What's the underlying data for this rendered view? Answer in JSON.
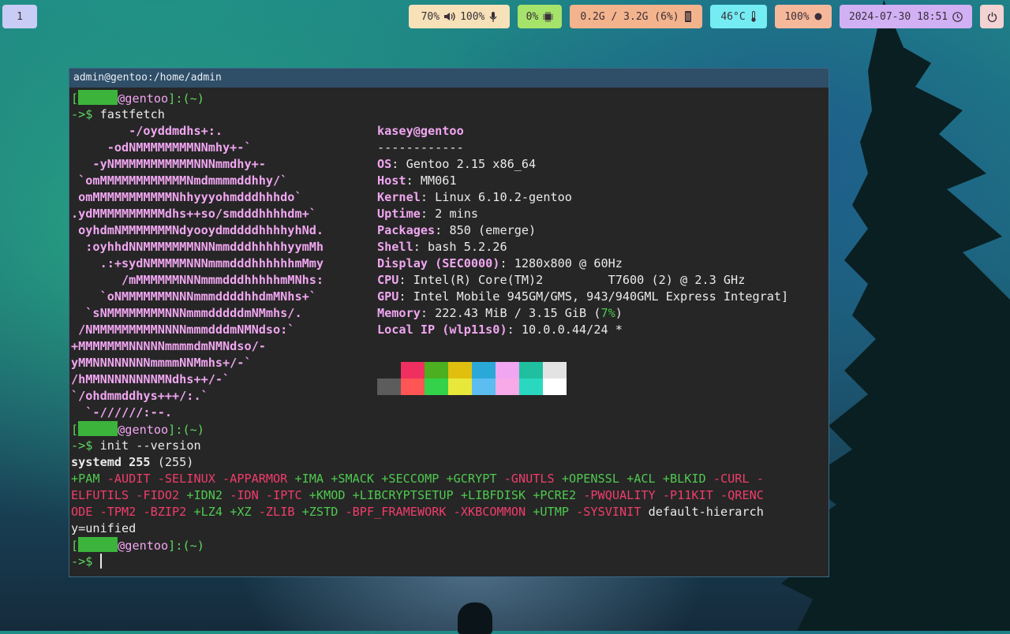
{
  "bar": {
    "workspace": "1",
    "audio": {
      "volume": "70%",
      "mic": "100%"
    },
    "cpu": "0%",
    "memory": "0.2G / 3.2G (6%)",
    "temperature": "46°C",
    "battery": "100%",
    "datetime": "2024-07-30 18:51",
    "colors": {
      "workspace": "#c9ccf5",
      "audio": "#f6e1b8",
      "cpu": "#a6e36a",
      "memory": "#f3b38c",
      "temp": "#74ecf2",
      "battery": "#f6b89a",
      "clock": "#d1b0f4",
      "power": "#f2d2d2"
    }
  },
  "terminal": {
    "title": "admin@gentoo:/home/admin",
    "prompt": {
      "open": "[",
      "host": "@gentoo",
      "close": "]",
      "path": ":(~)",
      "arrow": "->$"
    },
    "cmd1": "fastfetch",
    "cmd2": "init --version",
    "logo": [
      "        -/oyddmdhs+:.",
      "     -odNMMMMMMMMNNmhy+-`",
      "   -yNMMMMMMMMMMMNNNmmdhy+-",
      " `omMMMMMMMMMMMMNmdmmmmddhhy/`",
      " omMMMMMMMMMMMNhhyyyohmdddhhhdo`",
      ".ydMMMMMMMMMMdhs++so/smdddhhhhdm+`",
      " oyhdmNMMMMMMMNdyooydmddddhhhhyhNd.",
      "  :oyhhdNNMMMMMMMNNNmmdddhhhhhyymMh",
      "    .:+sydNMMMMMNNNmmmdddhhhhhhmMmy",
      "       /mMMMMMMNNNmmmdddhhhhhmMNhs:",
      "    `oNMMMMMMMNNNmmmddddhhdmMNhs+`",
      "  `sNMMMMMMMMNNNmmmdddddmNMmhs/.",
      " /NMMMMMMMMMNNNNmmmdddmNMNdso:`",
      "+MMMMMMMNNNNNmmmmdmNMNdso/-",
      "yMMNNNNNNNNmmmmNNMmhs+/-`",
      "/hMMNNNNNNNNMNdhs++/-`",
      "`/ohdmmddhys+++/:.`",
      "  `-//////:--."
    ],
    "info_header": "kasey@gentoo",
    "info_rule": "------------",
    "info": [
      {
        "key": "OS",
        "val": ": Gentoo 2.15 x86_64"
      },
      {
        "key": "Host",
        "val": ": MM061"
      },
      {
        "key": "Kernel",
        "val": ": Linux 6.10.2-gentoo"
      },
      {
        "key": "Uptime",
        "val": ": 2 mins"
      },
      {
        "key": "Packages",
        "val": ": 850 (emerge)"
      },
      {
        "key": "Shell",
        "val": ": bash 5.2.26"
      },
      {
        "key": "Display (SEC0000)",
        "val": ": 1280x800 @ 60Hz"
      },
      {
        "key": "CPU",
        "val": ": Intel(R) Core(TM)2         T7600 (2) @ 2.3 GHz"
      },
      {
        "key": "GPU",
        "val": ": Intel Mobile 945GM/GMS, 943/940GML Express Integrat]"
      },
      {
        "key": "Memory",
        "val": ": 222.43 MiB / 3.15 GiB (",
        "pct": "7%",
        "tail": ")"
      },
      {
        "key": "Local IP (wlp11s0)",
        "val": ": 10.0.0.44/24 *"
      }
    ],
    "palette_top": [
      "#262626",
      "#ef2f5f",
      "#4caf1f",
      "#e1bf0f",
      "#2aa8d8",
      "#f0a6f0",
      "#1fbf9f",
      "#e3e3e3"
    ],
    "palette_bottom": [
      "#5c5c5c",
      "#ff5555",
      "#33d24a",
      "#e8e83a",
      "#5cbdf0",
      "#f7a9e8",
      "#2ad8c0",
      "#ffffff"
    ],
    "systemd": {
      "name": "systemd 255",
      "ver": " (255)"
    },
    "features": [
      {
        "t": "+PAM",
        "on": true
      },
      {
        "t": "-AUDIT",
        "on": false
      },
      {
        "t": "-SELINUX",
        "on": false
      },
      {
        "t": "-APPARMOR",
        "on": false
      },
      {
        "t": "+IMA",
        "on": true
      },
      {
        "t": "+SMACK",
        "on": true
      },
      {
        "t": "+SECCOMP",
        "on": true
      },
      {
        "t": "+GCRYPT",
        "on": true
      },
      {
        "t": "-GNUTLS",
        "on": false
      },
      {
        "t": "+OPENSSL",
        "on": true
      },
      {
        "t": "+ACL",
        "on": true
      },
      {
        "t": "+BLKID",
        "on": true
      },
      {
        "t": "-CURL",
        "on": false
      },
      {
        "t": "-ELFUTILS",
        "on": false
      },
      {
        "t": "-FIDO2",
        "on": false
      },
      {
        "t": "+IDN2",
        "on": true
      },
      {
        "t": "-IDN",
        "on": false
      },
      {
        "t": "-IPTC",
        "on": false
      },
      {
        "t": "+KMOD",
        "on": true
      },
      {
        "t": "+LIBCRYPTSETUP",
        "on": true
      },
      {
        "t": "+LIBFDISK",
        "on": true
      },
      {
        "t": "+PCRE2",
        "on": true
      },
      {
        "t": "-PWQUALITY",
        "on": false
      },
      {
        "t": "-P11KIT",
        "on": false
      },
      {
        "t": "-QRENCODE",
        "on": false
      },
      {
        "t": "-TPM2",
        "on": false
      },
      {
        "t": "-BZIP2",
        "on": false
      },
      {
        "t": "+LZ4",
        "on": true
      },
      {
        "t": "+XZ",
        "on": true
      },
      {
        "t": "-ZLIB",
        "on": false
      },
      {
        "t": "+ZSTD",
        "on": true
      },
      {
        "t": "-BPF_FRAMEWORK",
        "on": false
      },
      {
        "t": "-XKBCOMMON",
        "on": false
      },
      {
        "t": "+UTMP",
        "on": true
      },
      {
        "t": "-SYSVINIT",
        "on": false
      },
      {
        "t": "default-hierarchy=unified",
        "on": null
      }
    ]
  }
}
